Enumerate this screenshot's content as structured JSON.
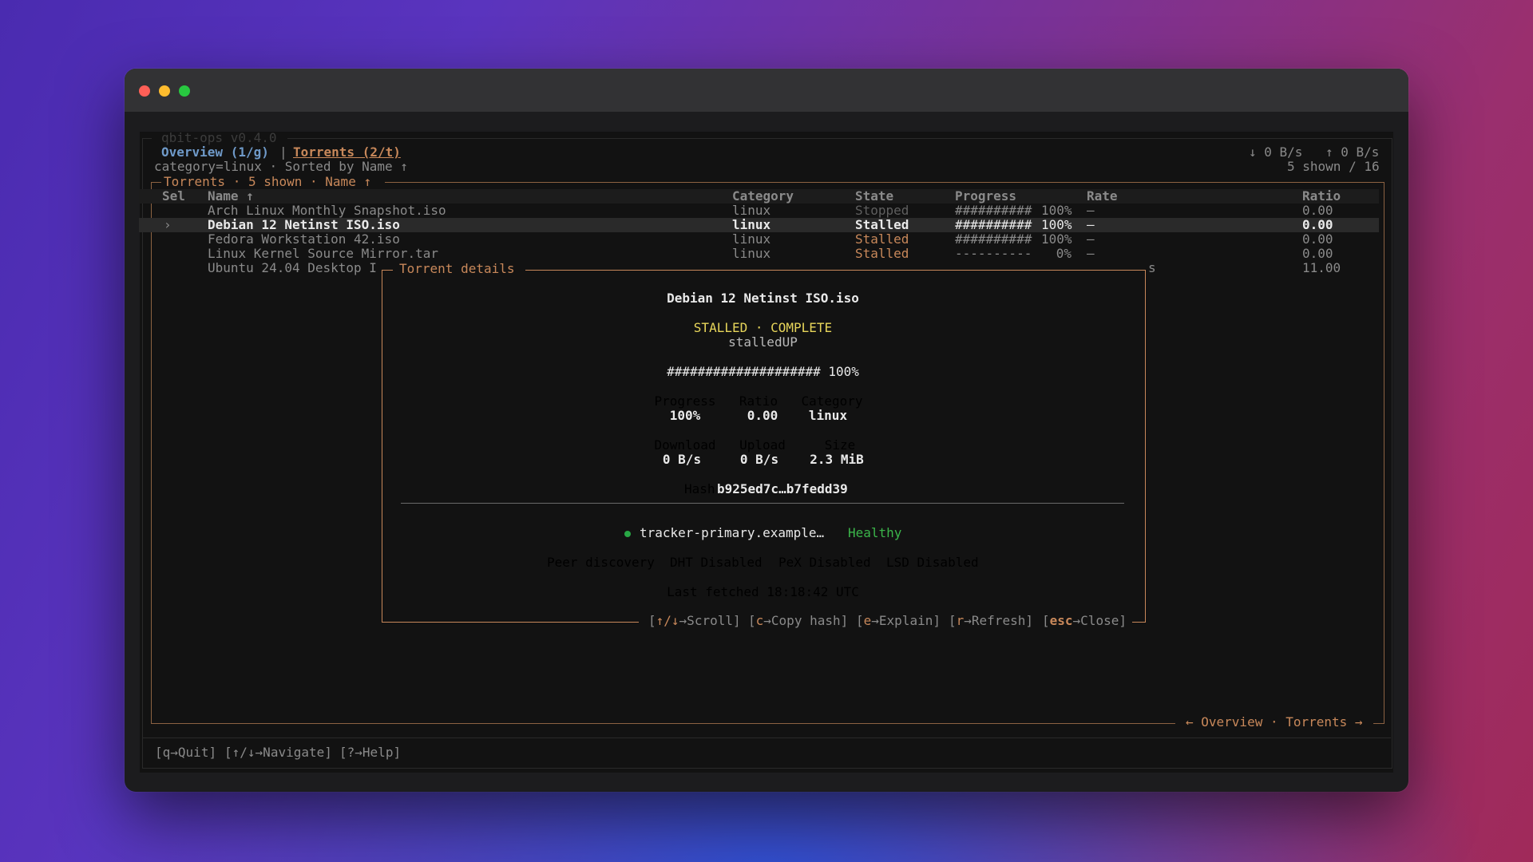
{
  "app": {
    "title": "qbit-ops v0.4.0"
  },
  "header": {
    "tabs": [
      {
        "label": "Overview (1/g)",
        "active": false
      },
      {
        "label": "Torrents (2/t)",
        "active": true
      }
    ],
    "separator": "|",
    "download_rate": "↓ 0 B/s",
    "upload_rate": "↑ 0 B/s",
    "filter_line": "category=linux · Sorted by Name ↑",
    "shown_count": "5 shown / 16"
  },
  "panel": {
    "title": "Torrents · 5 shown · Name ↑",
    "footer_nav": "← Overview · Torrents →"
  },
  "table": {
    "columns": [
      "Sel",
      "Name ↑",
      "Category",
      "State",
      "Progress",
      "Rate",
      "Ratio"
    ],
    "rows": [
      {
        "sel": "",
        "name": "Arch Linux Monthly Snapshot.iso",
        "category": "linux",
        "state": "Stopped",
        "progress_bar": "##########",
        "progress": "100%",
        "rate": "–",
        "ratio": "0.00"
      },
      {
        "sel": "›",
        "name": "Debian 12 Netinst ISO.iso",
        "category": "linux",
        "state": "Stalled",
        "progress_bar": "##########",
        "progress": "100%",
        "rate": "–",
        "ratio": "0.00"
      },
      {
        "sel": "",
        "name": "Fedora Workstation 42.iso",
        "category": "linux",
        "state": "Stalled",
        "progress_bar": "##########",
        "progress": "100%",
        "rate": "–",
        "ratio": "0.00"
      },
      {
        "sel": "",
        "name": "Linux Kernel Source Mirror.tar",
        "category": "linux",
        "state": "Stalled",
        "progress_bar": "----------",
        "progress": "0%",
        "rate": "–",
        "ratio": "0.00"
      },
      {
        "sel": "",
        "name": "Ubuntu 24.04 Desktop I",
        "category": "",
        "state": "",
        "progress_bar": "",
        "progress": "",
        "rate": "s",
        "ratio": "11.00"
      }
    ]
  },
  "details": {
    "title": "Torrent details",
    "name": "Debian 12 Netinst ISO.iso",
    "status": "STALLED · COMPLETE",
    "substatus": "stalledUP",
    "progress_bar": "#################### 100%",
    "stats": {
      "progress_label": "Progress",
      "progress_value": "100%",
      "ratio_label": "Ratio",
      "ratio_value": "0.00",
      "category_label": "Category",
      "category_value": "linux",
      "download_label": "Download",
      "download_value": "0 B/s",
      "upload_label": "Upload",
      "upload_value": "0 B/s",
      "size_label": "Size",
      "size_value": "2.3 MiB"
    },
    "hash_label": "Hash",
    "hash_value": "b925ed7c…b7fedd39",
    "tracker": {
      "name": "tracker-primary.example…",
      "status": "Healthy",
      "status_color": "#3bb54a"
    },
    "peer_discovery": {
      "label": "Peer discovery",
      "dht": "DHT Disabled",
      "pex": "PeX Disabled",
      "lsd": "LSD Disabled"
    },
    "last_fetched": "Last fetched 18:18:42 UTC",
    "keys": [
      {
        "key": "↑/↓",
        "action": "→Scroll"
      },
      {
        "key": "c",
        "action": "→Copy hash"
      },
      {
        "key": "e",
        "action": "→Explain"
      },
      {
        "key": "r",
        "action": "→Refresh"
      },
      {
        "key": "esc",
        "action": "→Close"
      }
    ]
  },
  "statusbar": {
    "keys": [
      {
        "key": "q",
        "action": "→Quit"
      },
      {
        "key": "↑/↓",
        "action": "→Navigate"
      },
      {
        "key": "?",
        "action": "→Help"
      }
    ]
  },
  "colors": {
    "accent": "#c8885a",
    "tab_active": "#c8885a",
    "tab_inactive": "#6f9ac9",
    "status_yellow": "#e7d55a",
    "healthy_green": "#3bb54a",
    "background": "#121212"
  }
}
